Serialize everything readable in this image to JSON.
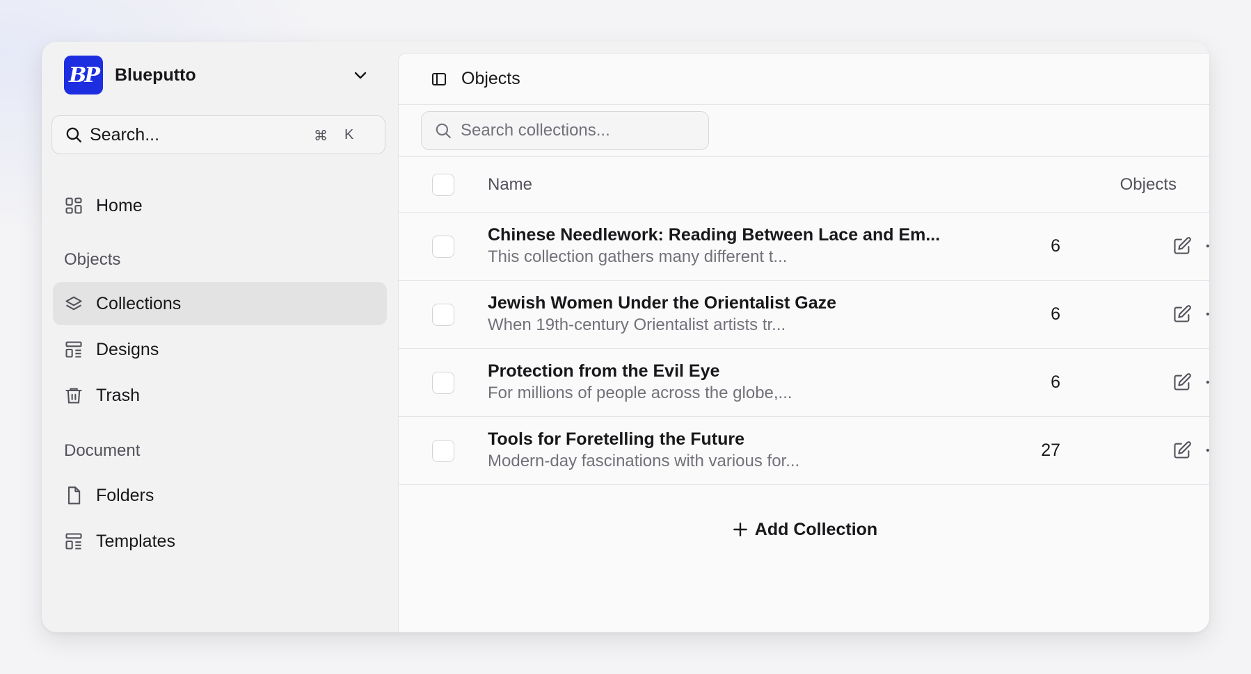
{
  "workspace": {
    "logo_text": "BP",
    "name": "Blueputto"
  },
  "search": {
    "placeholder": "Search...",
    "shortcut_symbol": "⌘",
    "shortcut_key": "K"
  },
  "sidebar": {
    "home": "Home",
    "section_objects": "Objects",
    "collections": "Collections",
    "designs": "Designs",
    "trash": "Trash",
    "section_document": "Document",
    "folders": "Folders",
    "templates": "Templates"
  },
  "main": {
    "title": "Objects",
    "search_placeholder": "Search collections...",
    "columns": {
      "name": "Name",
      "objects": "Objects"
    },
    "rows": [
      {
        "name": "Chinese Needlework: Reading Between Lace and Em...",
        "description": "This collection gathers many different t...",
        "count": "6"
      },
      {
        "name": "Jewish Women Under the Orientalist Gaze",
        "description": "When 19th-century Orientalist artists tr...",
        "count": "6"
      },
      {
        "name": "Protection from the Evil Eye",
        "description": "For millions of people across the globe,...",
        "count": "6"
      },
      {
        "name": "Tools for Foretelling the Future",
        "description": "Modern-day fascinations with various for...",
        "count": "27"
      }
    ],
    "add_label": "Add Collection"
  },
  "colors": {
    "brand": "#1d2ee0",
    "active_nav": "#e3e3e4",
    "border": "#e4e4e7"
  }
}
